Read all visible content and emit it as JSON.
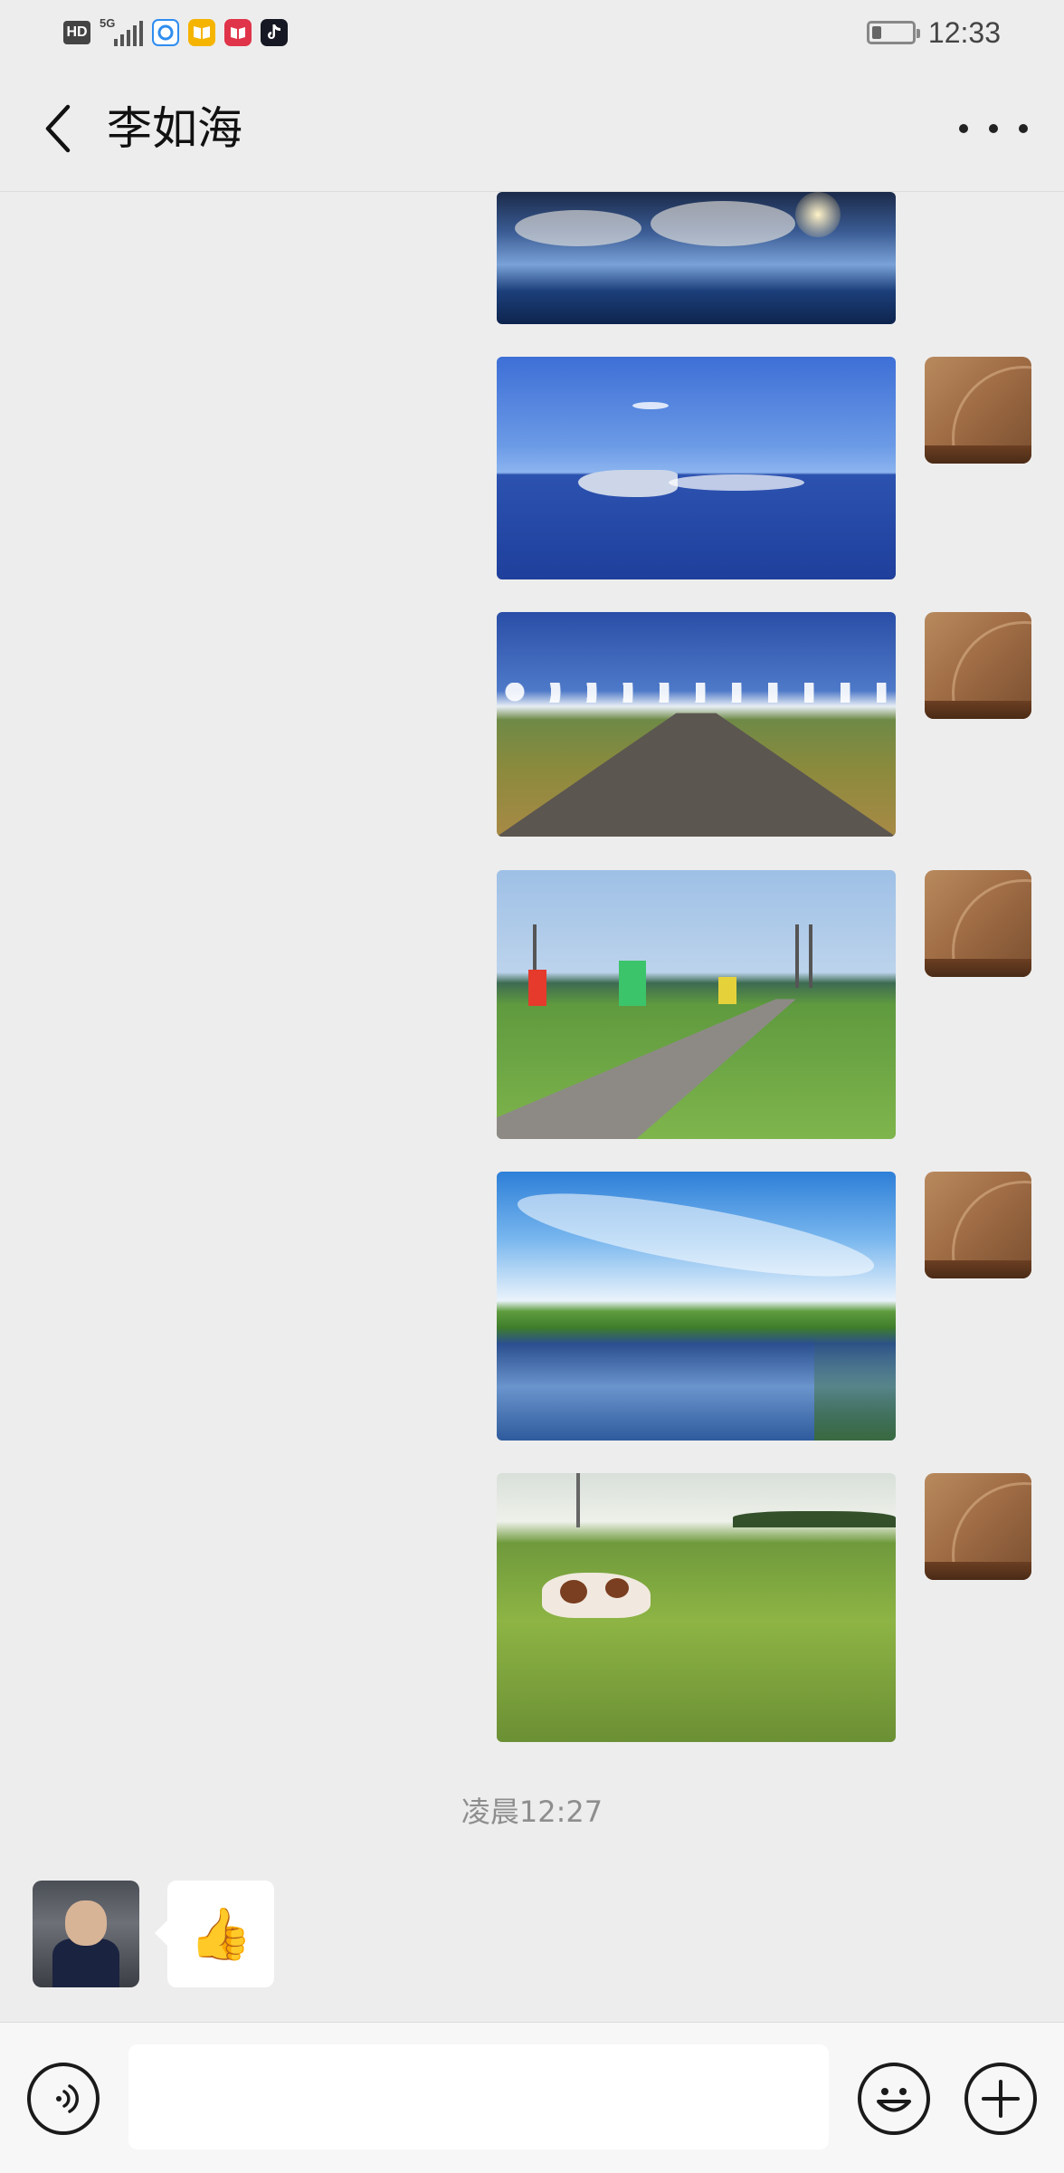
{
  "status_bar": {
    "hd_label": "HD",
    "network_label": "5G",
    "time": "12:33",
    "battery_percent": 25,
    "apps": [
      {
        "name": "browser-app-icon",
        "color": "#2f8df0"
      },
      {
        "name": "reader-app-icon",
        "color": "#f5b400"
      },
      {
        "name": "book-app-icon",
        "color": "#e0344a"
      },
      {
        "name": "tiktok-app-icon",
        "color": "#161823"
      }
    ]
  },
  "header": {
    "title": "李如海",
    "back_icon": "chevron-left-icon",
    "more_icon": "more-icon"
  },
  "messages": {
    "outgoing_images": [
      {
        "scene": "lake-reflection-sunset"
      },
      {
        "scene": "speedboat-on-lake"
      },
      {
        "scene": "wooden-boardwalk-grassland"
      },
      {
        "scene": "cyclists-with-flags-on-boardwalk"
      },
      {
        "scene": "river-reflection-blue-sky"
      },
      {
        "scene": "horses-in-meadow"
      }
    ],
    "timestamp": "凌晨12:27",
    "incoming_sticker": "👍"
  },
  "input_bar": {
    "voice_icon": "voice-icon",
    "emoji_icon": "emoji-icon",
    "plus_icon": "plus-icon",
    "input_value": ""
  },
  "colors": {
    "background": "#ededed",
    "bubble_in": "#ffffff",
    "timestamp": "#8e8e8e"
  }
}
